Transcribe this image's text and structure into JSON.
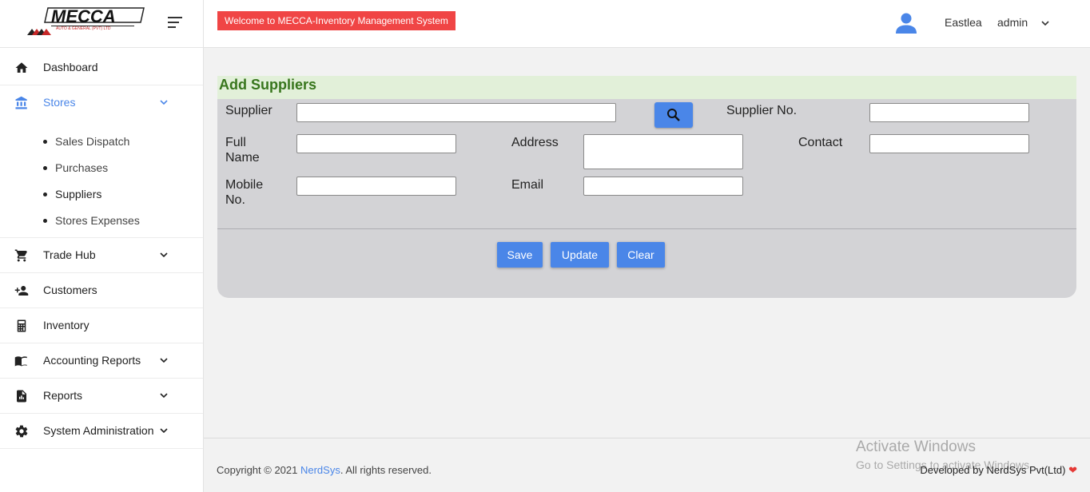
{
  "brand": {
    "logo_text": "MECCA",
    "logo_subtext": "AUTO & GENERAL (PVT) LTD"
  },
  "topbar": {
    "welcome": "Welcome to MECCA-Inventory Management System",
    "branch": "Eastlea",
    "username": "admin"
  },
  "sidebar": {
    "items": [
      {
        "label": "Dashboard",
        "icon": "home-icon"
      },
      {
        "label": "Stores",
        "icon": "bank-icon",
        "active": true
      },
      {
        "label": "Trade Hub",
        "icon": "cart-icon"
      },
      {
        "label": "Customers",
        "icon": "add-person-icon"
      },
      {
        "label": "Inventory",
        "icon": "calculator-icon"
      },
      {
        "label": "Accounting Reports",
        "icon": "book-icon"
      },
      {
        "label": "Reports",
        "icon": "report-icon"
      },
      {
        "label": "System Administration",
        "icon": "gear-icon"
      }
    ],
    "stores_sub": [
      "Sales Dispatch",
      "Purchases",
      "Suppliers",
      "Stores Expenses"
    ]
  },
  "form": {
    "title": "Add Suppliers",
    "supplier_label": "Supplier",
    "supplier_value": "",
    "supplier_no_label": "Supplier No.",
    "supplier_no_value": "",
    "full_name_label_1": "Full",
    "full_name_label_2": "Name",
    "full_name_value": "",
    "address_label": "Address",
    "address_value": "",
    "contact_label": "Contact",
    "contact_value": "",
    "mobile_label_1": "Mobile",
    "mobile_label_2": "No.",
    "mobile_value": "",
    "email_label": "Email",
    "email_value": "",
    "save_label": "Save",
    "update_label": "Update",
    "clear_label": "Clear"
  },
  "footer": {
    "copyright_prefix": "Copyright © 2021 ",
    "company": "NerdSys",
    "copyright_suffix": ". All rights reserved.",
    "developed_by": "Developed by NerdSys Pvt(Ltd)",
    "activate_title": "Activate Windows",
    "activate_sub": "Go to Settings to activate Windows."
  },
  "colors": {
    "accent": "#4a86e8",
    "welcome_bg": "#f04545",
    "title_bar_bg": "#e2f0d9",
    "title_text": "#38761d",
    "card_bg": "#d3d3d6"
  }
}
